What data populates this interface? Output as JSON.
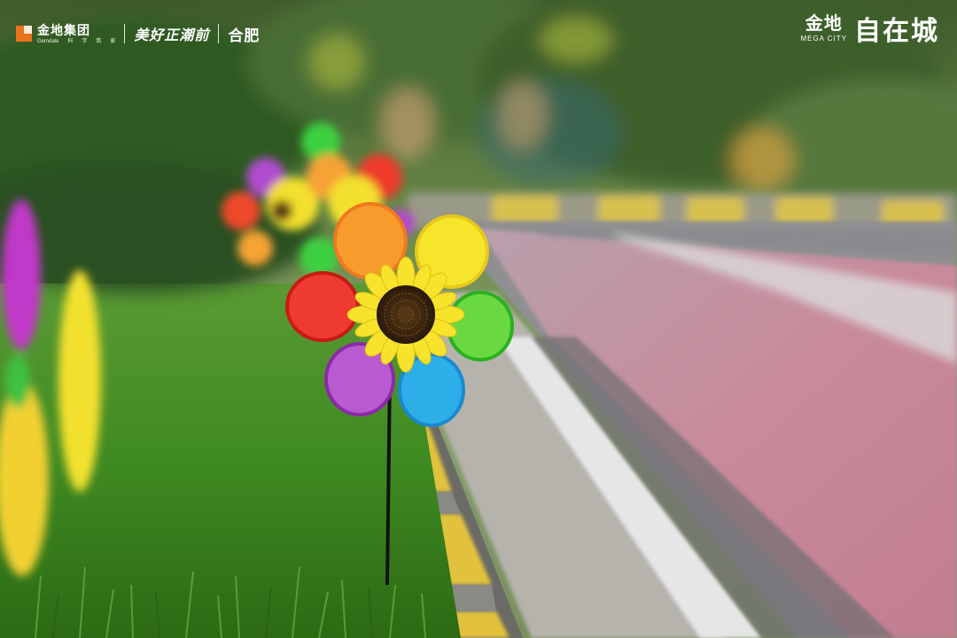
{
  "brand_left": {
    "gemdale_cn": "金地集团",
    "gemdale_en": "Gemdale",
    "gemdale_tagline": [
      "科",
      "学",
      "筑",
      "家"
    ],
    "slogan": "美好正潮前",
    "city": "合肥"
  },
  "brand_right": {
    "project_cn": "金地",
    "project_en": "MEGA CITY",
    "project_name": "自在城"
  },
  "colors": {
    "gemdale_orange": "#e8731c",
    "petal_red": "#ee2b22",
    "petal_orange": "#f7a234",
    "petal_yellow": "#f7e02a",
    "petal_green": "#57d63c",
    "petal_blue": "#2aa9e8",
    "petal_purple": "#b148c8",
    "bike_lane_pink": "#c98b9c",
    "grass_green": "#4a8a2a"
  }
}
